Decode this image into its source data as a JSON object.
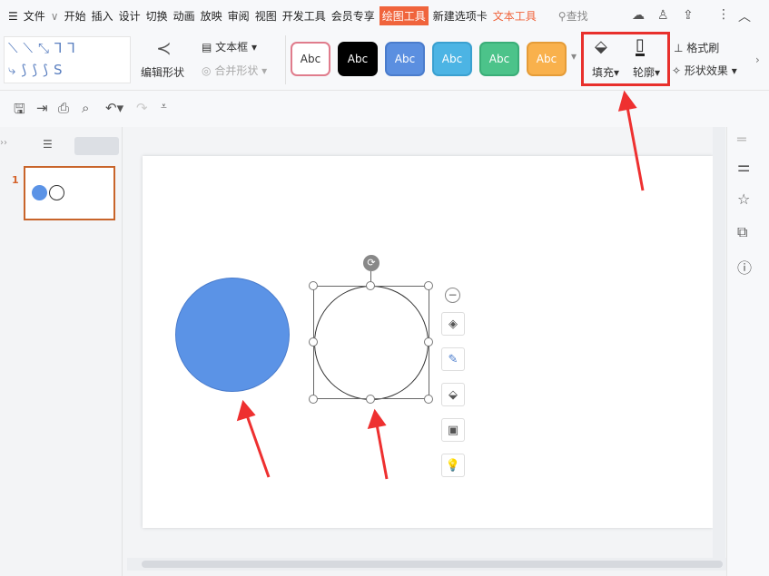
{
  "menubar": {
    "items": [
      "文件",
      "开始",
      "插入",
      "设计",
      "切换",
      "动画",
      "放映",
      "审阅",
      "视图",
      "开发工具",
      "会员专享",
      "绘图工具",
      "新建选项卡",
      "文本工具"
    ],
    "active": "绘图工具",
    "search": "查找"
  },
  "ribbon": {
    "edit_shape": "编辑形状",
    "text_box": "文本框",
    "merge_shape": "合并形状",
    "styles": [
      {
        "label": "Abc",
        "bg": "#ffffff",
        "fg": "#333333",
        "border": "#e07c8c"
      },
      {
        "label": "Abc",
        "bg": "#000000",
        "fg": "#ffffff",
        "border": "#000000"
      },
      {
        "label": "Abc",
        "bg": "#5b8fe0",
        "fg": "#ffffff",
        "border": "#4a7ccc"
      },
      {
        "label": "Abc",
        "bg": "#4cb4e4",
        "fg": "#ffffff",
        "border": "#3aa0d0"
      },
      {
        "label": "Abc",
        "bg": "#4cc38a",
        "fg": "#ffffff",
        "border": "#3aae78"
      },
      {
        "label": "Abc",
        "bg": "#f9b14c",
        "fg": "#ffffff",
        "border": "#e59c38"
      }
    ],
    "fill": "填充",
    "outline": "轮廓",
    "format_painter": "格式刷",
    "shape_effects": "形状效果"
  },
  "slides_panel": {
    "slide_number": "1"
  },
  "colors": {
    "accent": "#f0643c",
    "highlight_box": "#e8302c",
    "shape_fill": "#5b93e6"
  }
}
